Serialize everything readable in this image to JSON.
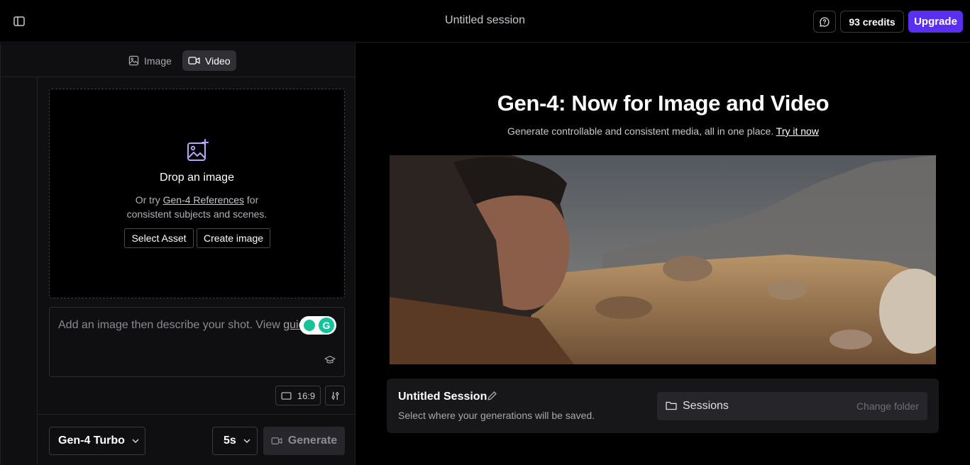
{
  "header": {
    "session_title": "Untitled session",
    "credits_label": "93 credits",
    "upgrade_label": "Upgrade"
  },
  "mode_tabs": [
    {
      "label": "Image",
      "active": false
    },
    {
      "label": "Video",
      "active": true
    }
  ],
  "dropzone": {
    "title": "Drop an image",
    "sub_prefix": "Or try ",
    "sub_link": "Gen-4 References",
    "sub_suffix": " for",
    "sub_line2": "consistent subjects and scenes.",
    "select_asset_label": "Select Asset",
    "create_image_label": "Create image"
  },
  "prompt": {
    "placeholder_text": "Add an image then describe your shot. View ",
    "guide_link": "guide"
  },
  "controls": {
    "aspect_ratio": "16:9",
    "model": "Gen-4 Turbo",
    "duration": "5s",
    "generate_label": "Generate"
  },
  "hero": {
    "title": "Gen-4: Now for Image and Video",
    "subtitle": "Generate controllable and consistent media, all in one place. ",
    "cta_link": "Try it now"
  },
  "session_card": {
    "title": "Untitled Session",
    "subtitle": "Select where your generations will be saved.",
    "folder_name": "Sessions",
    "change_folder_label": "Change folder"
  },
  "colors": {
    "accent": "#5b2ff0",
    "background": "#000000",
    "panel": "#0f0f11"
  }
}
